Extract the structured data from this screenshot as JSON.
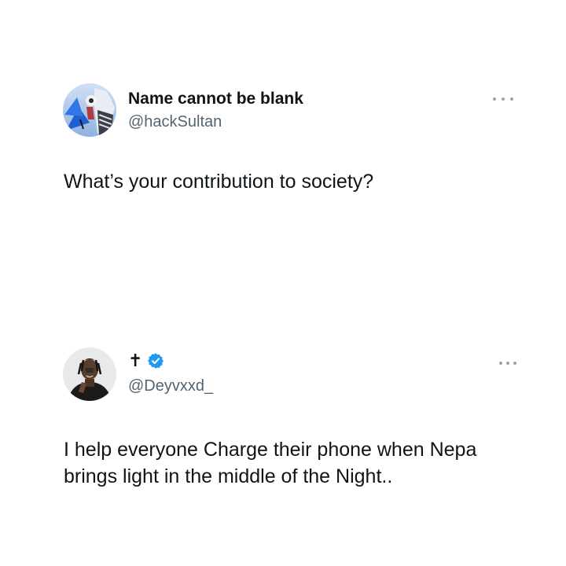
{
  "tweets": [
    {
      "display_name": "Name cannot be blank",
      "handle": "@hackSultan",
      "text": "What’s your contribution to society?",
      "avatar_icon": "anime-character-avatar",
      "more_icon": "more-options-icon"
    },
    {
      "display_name": "✝",
      "handle": "@Deyvxxd_",
      "verified": true,
      "text": "I help everyone Charge their phone when Nepa\nbrings light in the middle of the Night..",
      "avatar_icon": "person-photo-avatar",
      "more_icon": "more-options-icon"
    }
  ],
  "colors": {
    "text": "#0f1419",
    "secondary": "#536471",
    "verified": "#1d9bf0",
    "background": "#ffffff"
  }
}
